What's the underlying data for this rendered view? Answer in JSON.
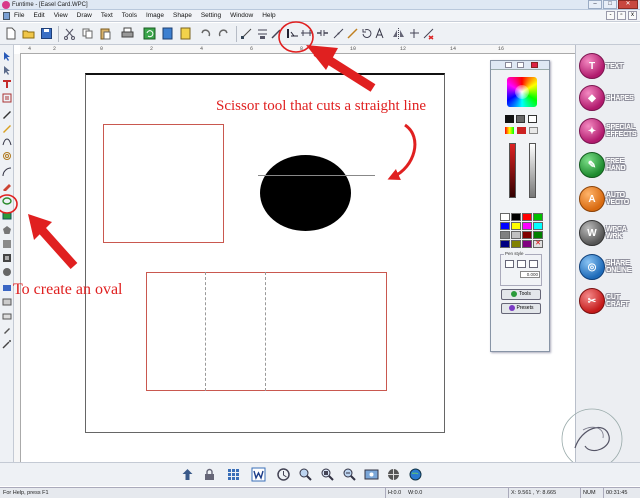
{
  "window": {
    "title": "Funtime - [Easel Card.WPC]",
    "min_label": "–",
    "max_label": "□",
    "close_label": "✕"
  },
  "menu": {
    "items": [
      "File",
      "Edit",
      "View",
      "Draw",
      "Text",
      "Tools",
      "Image",
      "Shape",
      "Setting",
      "Window",
      "Help"
    ]
  },
  "ruler": {
    "top_ticks": [
      "4",
      "2",
      "0",
      "2",
      "4",
      "6",
      "8",
      "10",
      "12",
      "14",
      "16"
    ]
  },
  "annotations": {
    "scissor_note": "Scissor tool that cuts a straight line",
    "oval_note": "To create an oval"
  },
  "color_panel": {
    "pen_style_label": "Pen style",
    "pen_width_value": "0.000",
    "tools_button": "Tools",
    "presets_button": "Presets"
  },
  "sidebar": {
    "items": [
      {
        "label": "TEXT",
        "glyph": "T"
      },
      {
        "label": "SHAPES",
        "glyph": "◆"
      },
      {
        "label": "SPECIAL EFFECTS",
        "glyph": "✦"
      },
      {
        "label": "FREE HAND",
        "glyph": "✎"
      },
      {
        "label": "AUTO VECTO",
        "glyph": "A"
      },
      {
        "label": "WPCA WRK",
        "glyph": "W"
      },
      {
        "label": "SHARE ONLINE",
        "glyph": "◎"
      },
      {
        "label": "CUT CRAFT",
        "glyph": "✂"
      }
    ]
  },
  "status": {
    "help_text": "For Help, press F1",
    "h_value": "H:0.0",
    "w_value": "W:0.0",
    "coords": "X: 9.561 , Y: 8.665",
    "num": "NUM",
    "time": "00:31:45"
  },
  "colors": {
    "annotation_red": "#e02020",
    "sidebar_magenta": "#b11a6d",
    "shape_outline": "#c9584f"
  }
}
